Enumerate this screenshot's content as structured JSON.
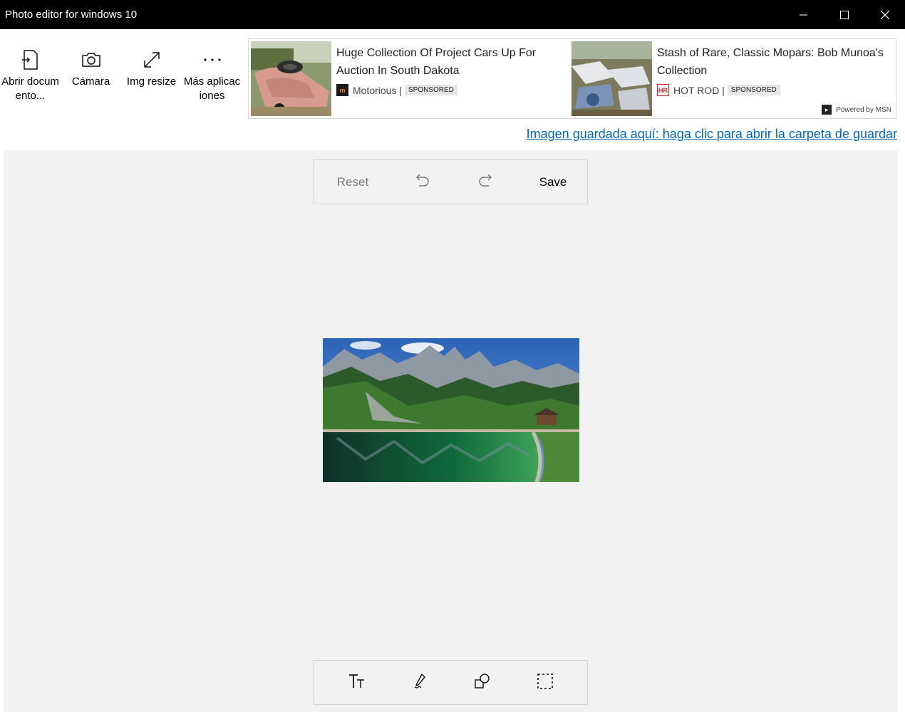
{
  "window": {
    "title": "Photo editor for windows 10",
    "controls": [
      "minimize-icon",
      "maximize-icon",
      "close-icon"
    ]
  },
  "toolbar": {
    "items": [
      {
        "icon": "open-document-icon",
        "label": "Abrir documento..."
      },
      {
        "icon": "camera-icon",
        "label": "Cámara"
      },
      {
        "icon": "resize-icon",
        "label": "Img resize"
      },
      {
        "icon": "more-icon",
        "label": "Más aplicaciones"
      }
    ]
  },
  "ads": [
    {
      "headline": "Huge Collection Of Project Cars Up For Auction In South Dakota",
      "source": "Motorious |",
      "badge": "SPONSORED"
    },
    {
      "headline": "Stash of Rare, Classic Mopars: Bob Munoa's Collection",
      "source": "HOT ROD |",
      "badge": "SPONSORED"
    }
  ],
  "powered_by": "Powered by MSN",
  "saved_link": "Imagen guardada aquí: haga clic para abrir la carpeta de guardar",
  "editbar": {
    "reset": "Reset",
    "save": "Save"
  },
  "bottom_tools": [
    "text-icon",
    "pen-icon",
    "shapes-icon",
    "crop-select-icon"
  ],
  "colors": {
    "titlebar": "#000000",
    "workspace": "#f2f2f2",
    "link": "#0067c0"
  }
}
